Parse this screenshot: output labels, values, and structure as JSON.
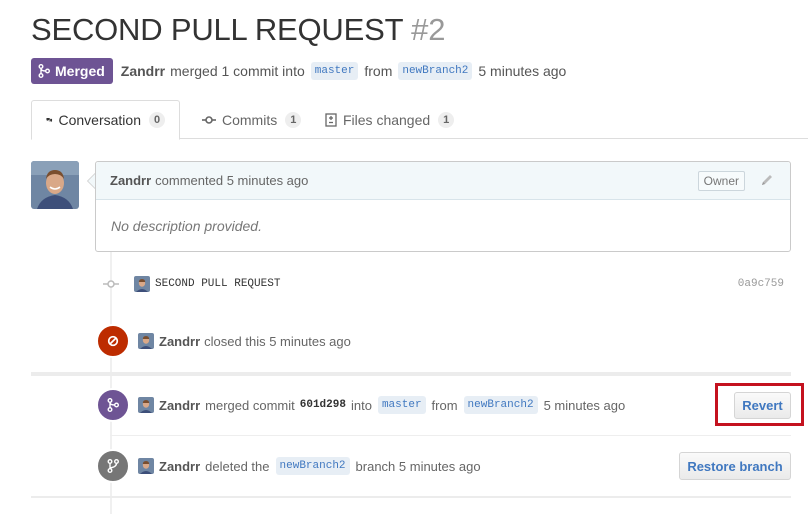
{
  "header": {
    "title": "SECOND PULL REQUEST",
    "number": "#2"
  },
  "meta": {
    "status_label": "Merged",
    "author": "Zandrr",
    "text_merged": "merged 1 commit into",
    "base_branch": "master",
    "text_from": "from",
    "head_branch": "newBranch2",
    "time": "5 minutes ago"
  },
  "tabs": [
    {
      "label": "Conversation",
      "count": "0",
      "icon": "comment-discussion-icon"
    },
    {
      "label": "Commits",
      "count": "1",
      "icon": "git-commit-icon"
    },
    {
      "label": "Files changed",
      "count": "1",
      "icon": "diff-icon"
    }
  ],
  "comment": {
    "author": "Zandrr",
    "action": "commented 5 minutes ago",
    "role_badge": "Owner",
    "body": "No description provided."
  },
  "commit": {
    "message": "SECOND PULL REQUEST",
    "sha": "0a9c759"
  },
  "events": {
    "closed": {
      "author": "Zandrr",
      "text": "closed this 5 minutes ago"
    },
    "merged": {
      "author": "Zandrr",
      "text_a": "merged commit",
      "sha": "601d298",
      "text_into": "into",
      "base_branch": "master",
      "text_from": "from",
      "head_branch": "newBranch2",
      "time": "5 minutes ago",
      "button": "Revert"
    },
    "deleted": {
      "author": "Zandrr",
      "text_a": "deleted the",
      "branch": "newBranch2",
      "text_b": "branch 5 minutes ago",
      "button": "Restore branch"
    }
  },
  "colors": {
    "merged_purple": "#6e5494",
    "closed_red": "#bd2c00",
    "deleted_gray": "#767676",
    "link_blue": "#4078c0",
    "highlight_red": "#c4121f"
  }
}
